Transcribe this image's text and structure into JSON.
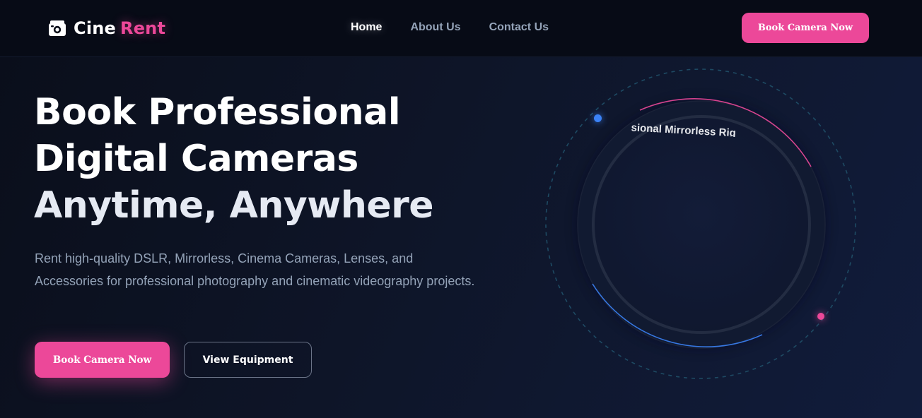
{
  "brand": {
    "name_part1": "Cine",
    "name_part2": "Rent",
    "icon": "camera-icon",
    "accent_color": "#ec4899"
  },
  "nav": {
    "links": [
      {
        "label": "Home",
        "active": true
      },
      {
        "label": "About Us",
        "active": false
      },
      {
        "label": "Contact Us",
        "active": false
      }
    ],
    "cta_label": "Book Camera Now"
  },
  "hero": {
    "title_lines": [
      "Book Professional",
      "Digital Cameras",
      "Anytime, Anywhere"
    ],
    "description": "Rent high-quality DSLR, Mirrorless, Cinema Cameras, Lenses, and Accessories for professional photography and cinematic videography projects.",
    "primary_button": "Book Camera Now",
    "secondary_button": "View Equipment"
  },
  "orbit": {
    "label": "Professional Mirrorless Rig",
    "colors": {
      "pink": "#ec4899",
      "blue": "#3b82f6",
      "dashed": "#1e4a63"
    }
  }
}
